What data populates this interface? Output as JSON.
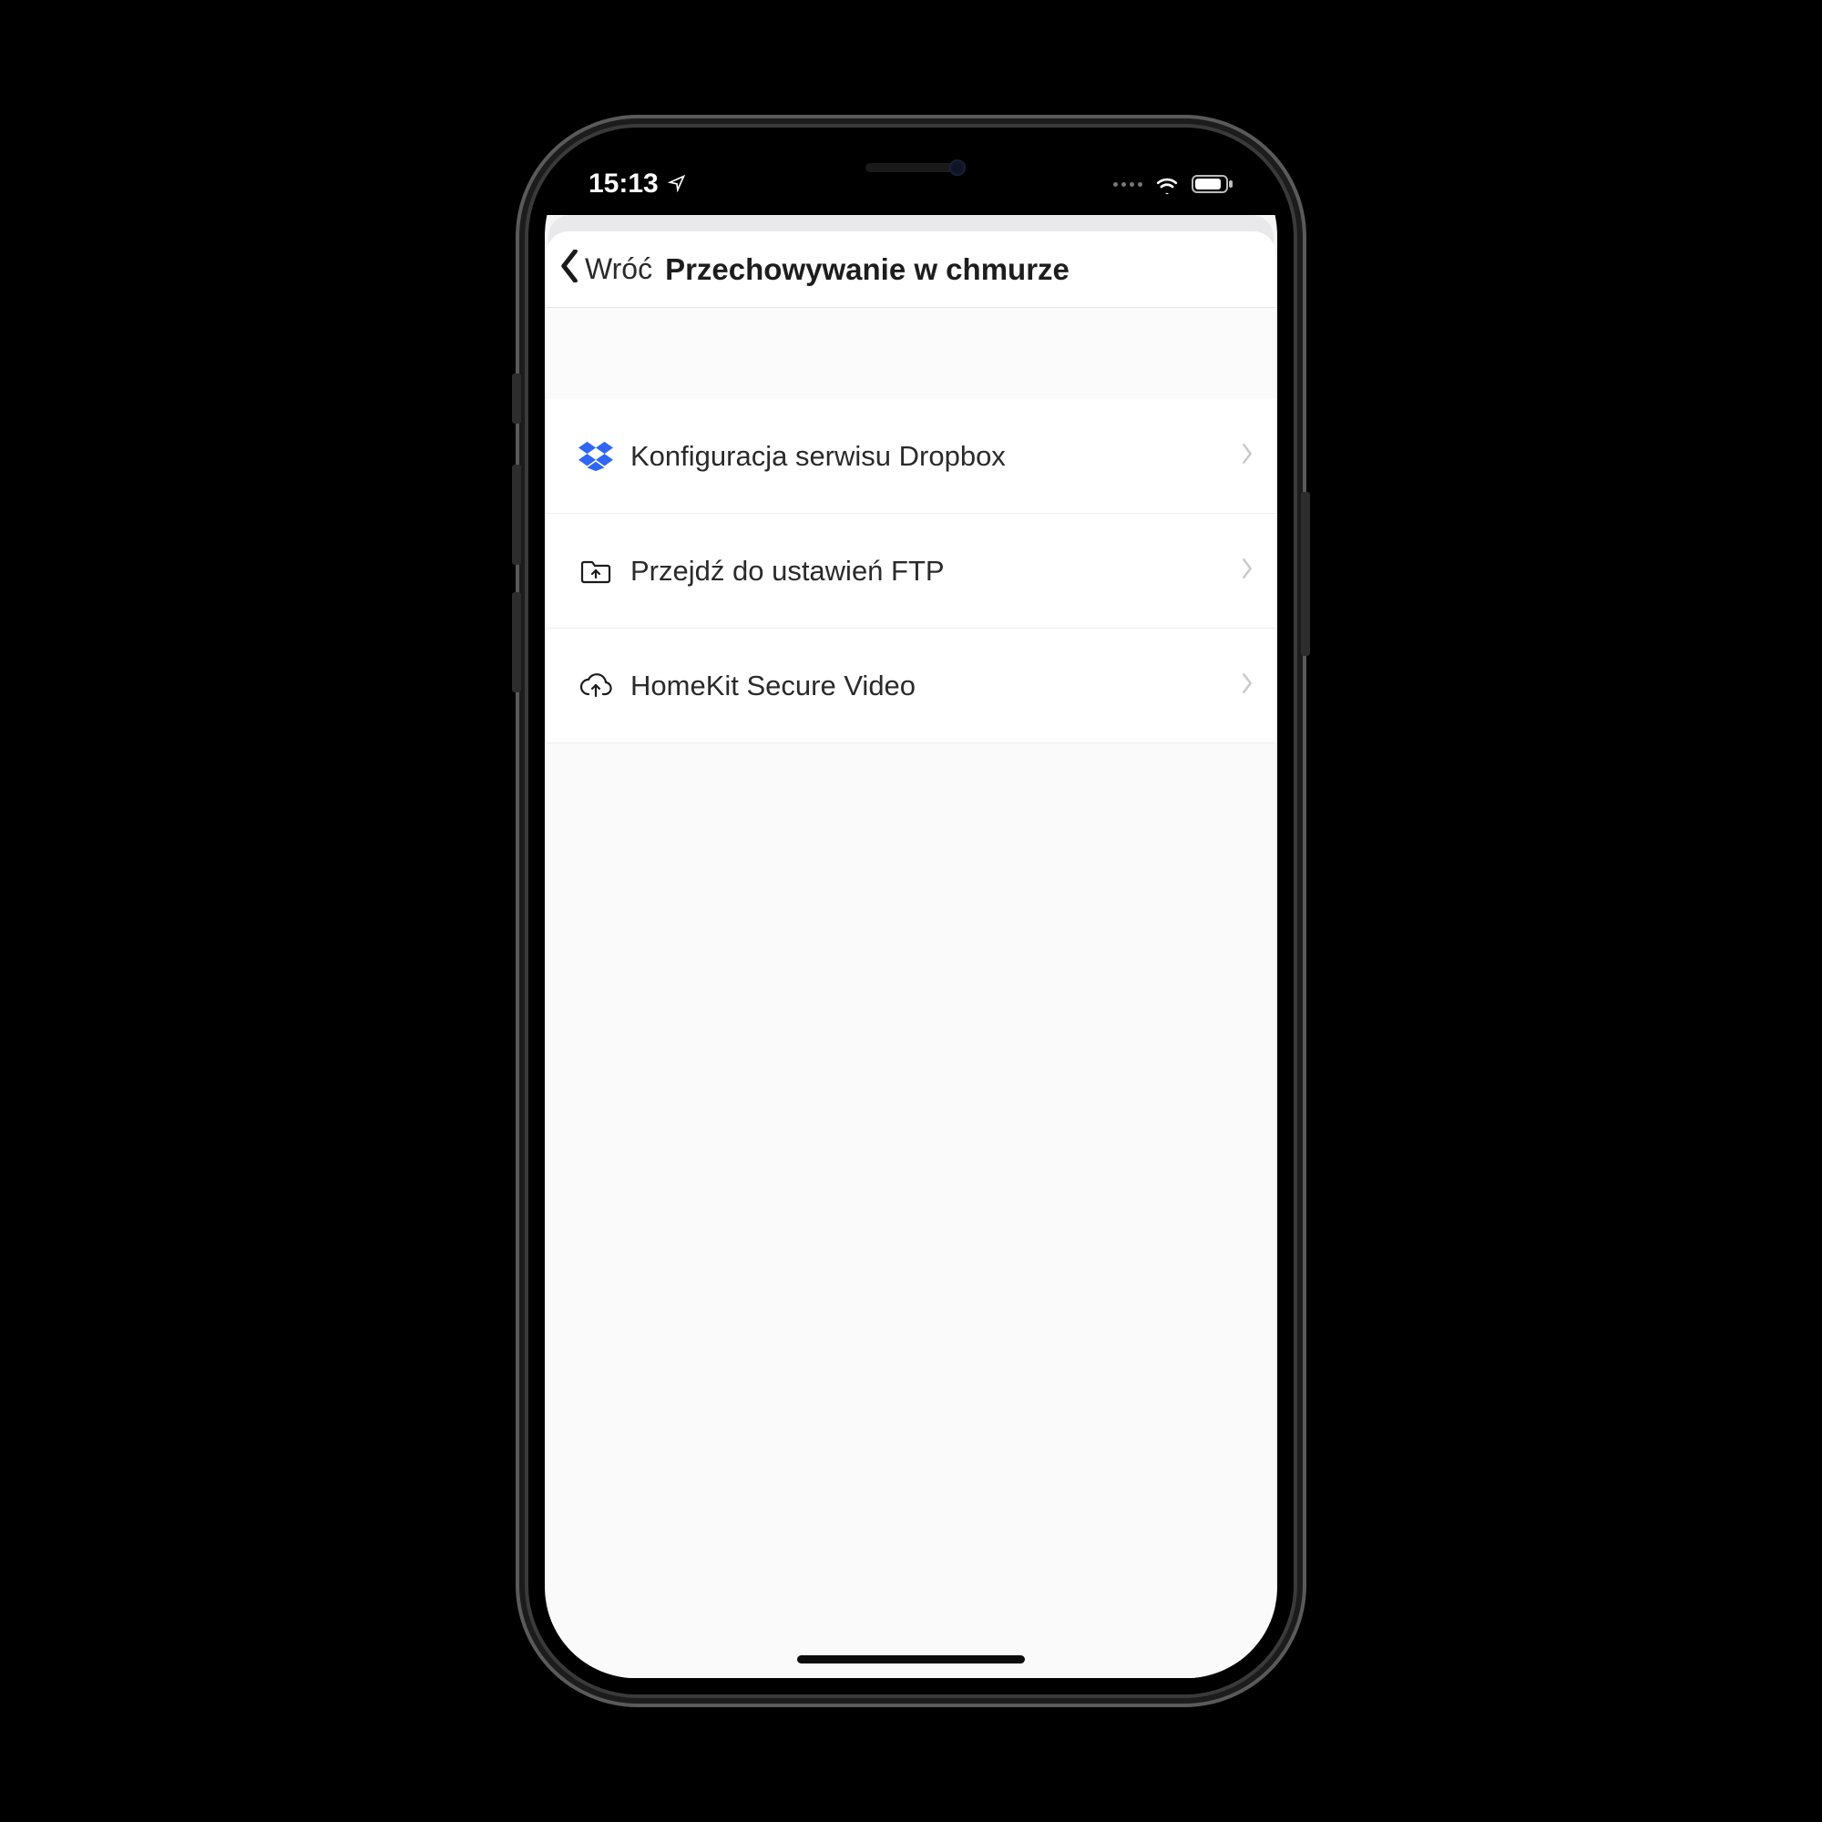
{
  "statusbar": {
    "time": "15:13"
  },
  "nav": {
    "back_label": "Wróć",
    "title": "Przechowywanie w chmurze"
  },
  "rows": [
    {
      "icon": "dropbox-icon",
      "label": "Konfiguracja serwisu Dropbox"
    },
    {
      "icon": "ftp-folder-icon",
      "label": "Przejdź do ustawień FTP"
    },
    {
      "icon": "cloud-upload-icon",
      "label": "HomeKit Secure Video"
    }
  ]
}
